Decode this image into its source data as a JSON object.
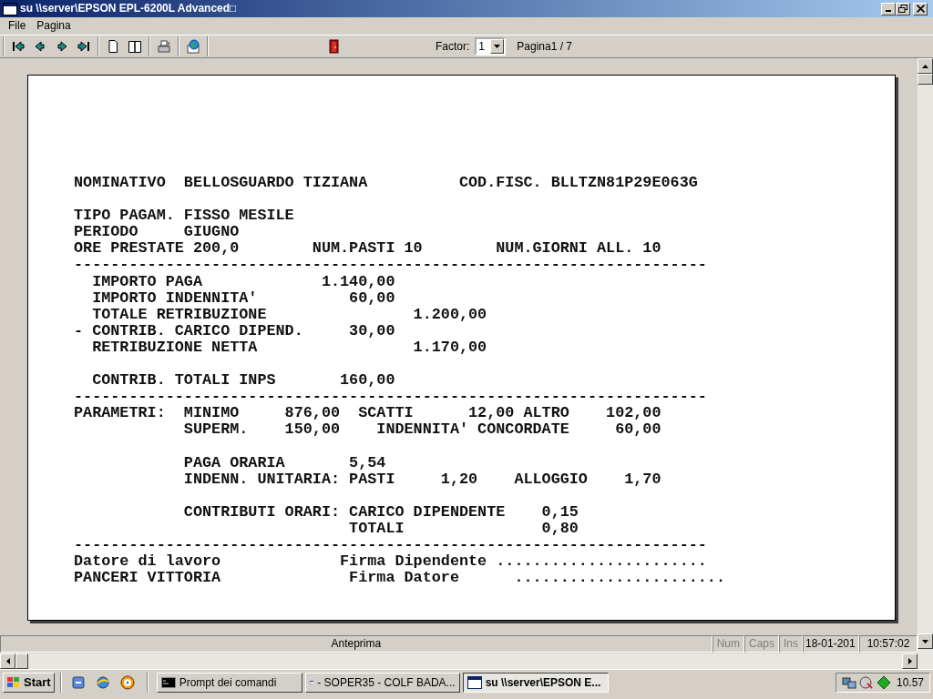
{
  "window": {
    "title": "su \\\\server\\EPSON EPL-6200L Advanced□"
  },
  "menu": [
    "File",
    "Pagina"
  ],
  "toolbar": {
    "factor_label": "Factor:",
    "factor_value": "1",
    "page_label": "Pagina1 / 7"
  },
  "document": {
    "blocks": [
      {
        "lines": [
          "NOMINATIVO  BELLOSGUARDO TIZIANA          COD.FISC. BLLTZN81P29E063G"
        ]
      },
      {
        "lines": [
          "TIPO PAGAM. FISSO MESILE",
          "PERIODO     GIUGNO",
          "ORE PRESTATE 200,0        NUM.PASTI 10        NUM.GIORNI ALL. 10",
          "---------------------------------------------------------------------",
          "  IMPORTO PAGA             1.140,00",
          "  IMPORTO INDENNITA'          60,00",
          "  TOTALE RETRIBUZIONE                1.200,00",
          "- CONTRIB. CARICO DIPEND.     30,00",
          "  RETRIBUZIONE NETTA                 1.170,00"
        ]
      },
      {
        "lines": [
          "  CONTRIB. TOTALI INPS       160,00",
          "---------------------------------------------------------------------",
          "PARAMETRI:  MINIMO     876,00  SCATTI      12,00 ALTRO    102,00",
          "            SUPERM.    150,00    INDENNITA' CONCORDATE     60,00"
        ]
      },
      {
        "lines": [
          "            PAGA ORARIA       5,54",
          "            INDENN. UNITARIA: PASTI     1,20    ALLOGGIO    1,70"
        ]
      },
      {
        "lines": [
          "            CONTRIBUTI ORARI: CARICO DIPENDENTE    0,15",
          "                              TOTALI               0,80",
          "---------------------------------------------------------------------",
          "Datore di lavoro             Firma Dipendente .......................",
          "PANCERI VITTORIA              Firma Datore      ......................."
        ]
      }
    ]
  },
  "status_bar": {
    "message": "Anteprima",
    "indicators": [
      {
        "label": "Num",
        "on": false
      },
      {
        "label": "Caps",
        "on": false
      },
      {
        "label": "Ins",
        "on": false
      }
    ],
    "date": "18-01-201",
    "time": "10:57:02"
  },
  "taskbar": {
    "start": "Start",
    "tasks": [
      {
        "label": "Prompt dei comandi",
        "kind": "console",
        "selected": false
      },
      {
        "label": "- SOPER35 - COLF BADA...",
        "kind": "window",
        "selected": false
      },
      {
        "label": "su \\\\server\\EPSON E...",
        "kind": "window",
        "selected": true
      }
    ],
    "clock": "10.57"
  }
}
